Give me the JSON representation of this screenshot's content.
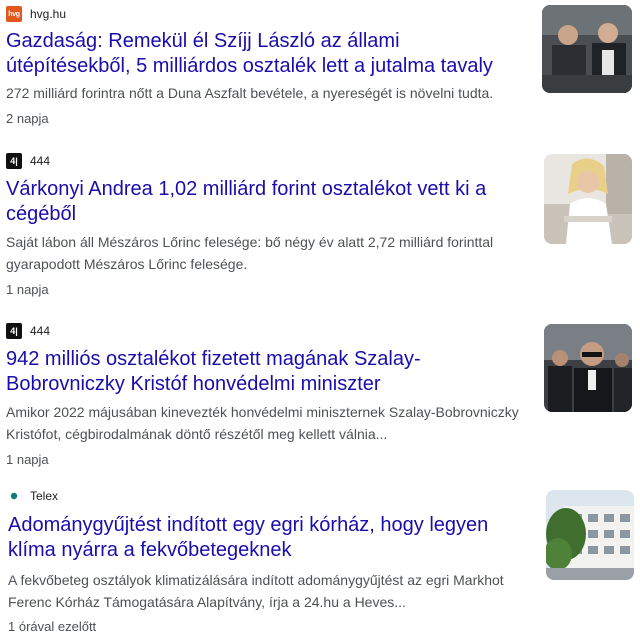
{
  "results": [
    {
      "source": "hvg.hu",
      "favicon": "hvg",
      "title": "Gazdaság: Remekül él Szíjj László az állami útépítésekből, 5 milliárdos osztalék lett a jutalma tavaly",
      "snippet": "272 milliárd forintra nőtt a Duna Aszfalt bevétele, a nyereségét is növelni tudta.",
      "time": "2 napja"
    },
    {
      "source": "444",
      "favicon": "444",
      "title": "Várkonyi Andrea 1,02 milliárd forint osztalékot vett ki a cégéből",
      "snippet": "Saját lábon áll Mészáros Lőrinc felesége: bő négy év alatt 2,72 milliárd forinttal gyarapodott Mészáros Lőrinc felesége.",
      "time": "1 napja"
    },
    {
      "source": "444",
      "favicon": "444",
      "title": "942 milliós osztalékot fizetett magának Szalay-Bobrovniczky Kristóf honvédelmi miniszter",
      "snippet": "Amikor 2022 májusában kinevezték honvédelmi miniszternek Szalay-Bobrovniczky Kristófot, cégbirodalmának döntő részétől meg kellett válnia...",
      "time": "1 napja"
    },
    {
      "source": "Telex",
      "favicon": "telex",
      "title": "Adománygyűjtést indított egy egri kórház, hogy legyen klíma nyárra a fekvőbetegeknek",
      "snippet": "A fekvőbeteg osztályok klimatizálására indított adománygyűjtést az egri Markhot Ferenc Kórház Támogatására Alapítvány, írja a 24.hu a Heves...",
      "time": "1 órával ezelőtt"
    }
  ],
  "favicon_labels": {
    "hvg": "hvg",
    "444": "4|"
  },
  "colors": {
    "link": "#1a0dab",
    "snippet": "#4d5156",
    "hvg": "#e2571e"
  }
}
